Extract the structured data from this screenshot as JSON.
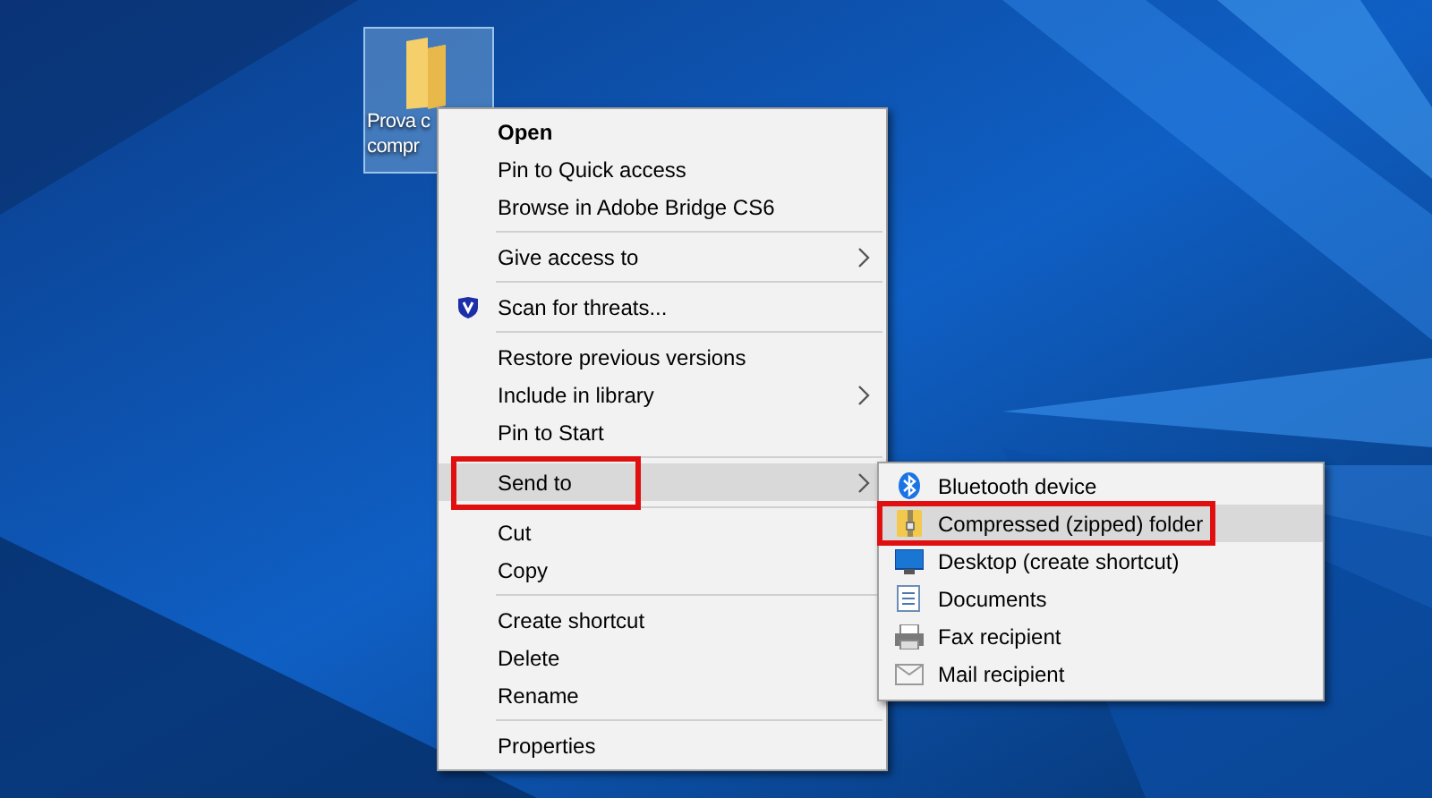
{
  "desktop_icon": {
    "label_lines": [
      "Prova c",
      "compr"
    ],
    "selected": true
  },
  "context_menu": {
    "items": [
      {
        "kind": "item",
        "label": "Open",
        "bold": true,
        "submenu": false,
        "selected": false,
        "marked": false
      },
      {
        "kind": "item",
        "label": "Pin to Quick access",
        "bold": false,
        "submenu": false,
        "selected": false,
        "marked": false
      },
      {
        "kind": "item",
        "label": "Browse in Adobe Bridge CS6",
        "bold": false,
        "submenu": false,
        "selected": false,
        "marked": false
      },
      {
        "kind": "separator"
      },
      {
        "kind": "item",
        "label": "Give access to",
        "bold": false,
        "submenu": true,
        "selected": false,
        "marked": false
      },
      {
        "kind": "separator"
      },
      {
        "kind": "shielded",
        "label": "Scan for threats...",
        "bold": false,
        "submenu": false,
        "selected": false,
        "marked": false
      },
      {
        "kind": "separator"
      },
      {
        "kind": "item",
        "label": "Restore previous versions",
        "bold": false,
        "submenu": false,
        "selected": false,
        "marked": false
      },
      {
        "kind": "item",
        "label": "Include in library",
        "bold": false,
        "submenu": true,
        "selected": false,
        "marked": false
      },
      {
        "kind": "item",
        "label": "Pin to Start",
        "bold": false,
        "submenu": false,
        "selected": false,
        "marked": false
      },
      {
        "kind": "separator"
      },
      {
        "kind": "item",
        "label": "Send to",
        "bold": false,
        "submenu": true,
        "selected": true,
        "marked": true
      },
      {
        "kind": "separator"
      },
      {
        "kind": "item",
        "label": "Cut",
        "bold": false,
        "submenu": false,
        "selected": false,
        "marked": false
      },
      {
        "kind": "item",
        "label": "Copy",
        "bold": false,
        "submenu": false,
        "selected": false,
        "marked": false
      },
      {
        "kind": "separator"
      },
      {
        "kind": "item",
        "label": "Create shortcut",
        "bold": false,
        "submenu": false,
        "selected": false,
        "marked": false
      },
      {
        "kind": "item",
        "label": "Delete",
        "bold": false,
        "submenu": false,
        "selected": false,
        "marked": false
      },
      {
        "kind": "item",
        "label": "Rename",
        "bold": false,
        "submenu": false,
        "selected": false,
        "marked": false
      },
      {
        "kind": "separator"
      },
      {
        "kind": "item",
        "label": "Properties",
        "bold": false,
        "submenu": false,
        "selected": false,
        "marked": false
      }
    ]
  },
  "send_to_menu": {
    "items": [
      {
        "kind": "bluetooth",
        "label": "Bluetooth device",
        "selected": false,
        "marked": false
      },
      {
        "kind": "zip",
        "label": "Compressed (zipped) folder",
        "selected": true,
        "marked": true
      },
      {
        "kind": "desktop",
        "label": "Desktop (create shortcut)",
        "selected": false,
        "marked": false
      },
      {
        "kind": "documents",
        "label": "Documents",
        "selected": false,
        "marked": false
      },
      {
        "kind": "fax",
        "label": "Fax recipient",
        "selected": false,
        "marked": false
      },
      {
        "kind": "mail",
        "label": "Mail recipient",
        "selected": false,
        "marked": false
      }
    ]
  }
}
